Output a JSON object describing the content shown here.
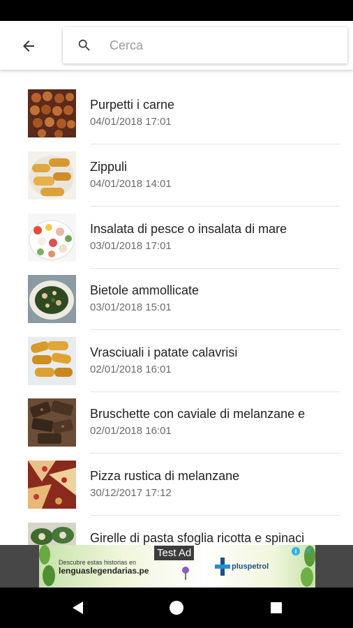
{
  "search": {
    "placeholder": "Cerca"
  },
  "recipes": [
    {
      "title": "Purpetti i carne",
      "date": "04/01/2018 17:01"
    },
    {
      "title": "Zippuli",
      "date": "04/01/2018 14:01"
    },
    {
      "title": "Insalata di pesce o insalata di mare",
      "date": "03/01/2018 17:01"
    },
    {
      "title": "Bietole ammollicate",
      "date": "03/01/2018 15:01"
    },
    {
      "title": "Vrasciuali i patate calavrisi",
      "date": "02/01/2018 16:01"
    },
    {
      "title": "Bruschette con caviale di melanzane e",
      "date": "02/01/2018 16:01"
    },
    {
      "title": "Pizza rustica di melanzane",
      "date": "30/12/2017 17:12"
    },
    {
      "title": "Girelle di pasta sfoglia ricotta e spinaci",
      "date": ""
    }
  ],
  "ad": {
    "test_label": "Test Ad",
    "line1": "Descubre estas historias en",
    "line2": "lenguaslegendarias.pe",
    "brand": "pluspetrol",
    "info": "i",
    "close": "✕"
  },
  "colors": {
    "status_bar": "#000000",
    "nav_bar": "#000000",
    "ad_background": "#474747",
    "title_text": "#222222",
    "date_text": "#6b6b6b"
  }
}
